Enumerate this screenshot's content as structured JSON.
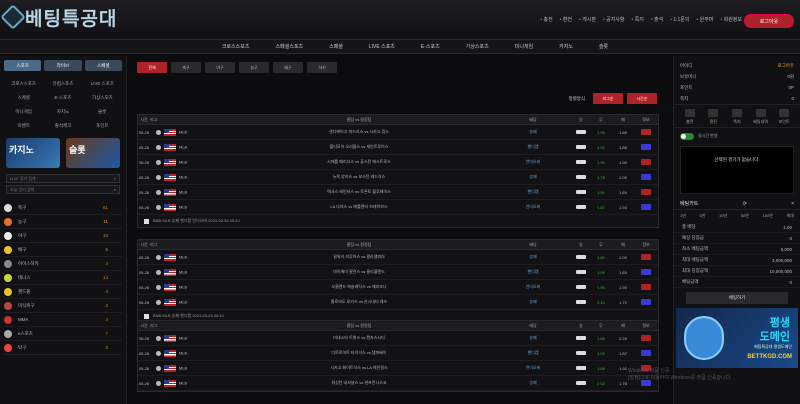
{
  "header": {
    "logo_text": "베팅특공대",
    "nav": [
      "충전",
      "환전",
      "게시판",
      "공지사항",
      "쪽지",
      "출석",
      "1:1문의",
      "원주머",
      "회원정보"
    ],
    "login_btn": "로그아웃"
  },
  "menu": [
    "크로스스포츠",
    "스페셜스포츠",
    "스페셜",
    "LIVE 스포츠",
    "E-스포츠",
    "가상스포츠",
    "미니게임",
    "카지노",
    "슬롯"
  ],
  "sidebar": {
    "btns": [
      "스포츠",
      "라이브",
      "스페셜"
    ],
    "grid": [
      "크로스스포츠",
      "유럽스포츠",
      "LIVE 스포츠",
      "스페셜",
      "E-스포츠",
      "가상스포츠",
      "미니게임",
      "카지노",
      "슬롯",
      "이벤트",
      "출석체크",
      "포인트"
    ],
    "banner_a": "카지노",
    "banner_b": "슬롯",
    "inputs": [
      "LIVE 경기 검색",
      "오늘 경기 검색"
    ],
    "sports": [
      {
        "name": "축구",
        "count": "61",
        "color": "#ddd"
      },
      {
        "name": "농구",
        "count": "11",
        "color": "#e8742a"
      },
      {
        "name": "야구",
        "count": "34",
        "color": "#eee"
      },
      {
        "name": "배구",
        "count": "5",
        "color": "#e8c42a"
      },
      {
        "name": "아이스하키",
        "count": "3",
        "color": "#888"
      },
      {
        "name": "테니스",
        "count": "14",
        "color": "#c8d83a"
      },
      {
        "name": "핸드볼",
        "count": "4",
        "color": "#e8c42a"
      },
      {
        "name": "미식축구",
        "count": "2",
        "color": "#b44"
      },
      {
        "name": "MMA",
        "count": "3",
        "color": "#c33"
      },
      {
        "name": "e스포츠",
        "count": "7",
        "color": "#aaa"
      },
      {
        "name": "탁구",
        "count": "2",
        "color": "#e44"
      }
    ]
  },
  "main": {
    "tabs": [
      "전체",
      "축구",
      "야구",
      "농구",
      "배구",
      "하키"
    ],
    "sort_label": "정렬방식",
    "sort_btns": [
      "리그순",
      "시간순"
    ],
    "tables": [
      {
        "head": [
          "시간",
          "리그",
          "홈팀 vs 원정팀",
          "배당",
          "승",
          "무",
          "패",
          "정보"
        ],
        "rows": [
          {
            "time": "05-26",
            "league": "MLB",
            "match": "샌디에이고 파드리스 vs 시카고 컵스",
            "market": "승패",
            "o1": "1.95",
            "o2": "",
            "o3": "1.85",
            "note": "정보"
          },
          {
            "time": "05-26",
            "league": "MLB",
            "match": "볼티모어 오리올스 vs 세인트루이스",
            "market": "핸디캡",
            "o1": "1.92",
            "o2": "",
            "o3": "1.88",
            "note": "정보"
          },
          {
            "time": "05-26",
            "league": "MLB",
            "match": "시애틀 매리너스 vs 휴스턴 애스트로스",
            "market": "언더오버",
            "o1": "1.90",
            "o2": "",
            "o3": "1.90",
            "note": "정보"
          },
          {
            "time": "05-26",
            "league": "MLB",
            "match": "뉴욕 양키스 vs 보스턴 레드삭스",
            "market": "승패",
            "o1": "1.75",
            "o2": "",
            "o3": "2.05",
            "note": "정보"
          },
          {
            "time": "05-26",
            "league": "MLB",
            "match": "텍사스 레인저스 vs 토론토 블루제이스",
            "market": "핸디캡",
            "o1": "1.91",
            "o2": "",
            "o3": "1.89",
            "note": "정보"
          },
          {
            "time": "05-26",
            "league": "MLB",
            "match": "LA 다저스 vs 애틀랜타 브레이브스",
            "market": "언더오버",
            "o1": "1.87",
            "o2": "",
            "o3": "1.93",
            "note": "정보"
          }
        ],
        "note": "BNB MLB 승패 핸디캡 언더오버 2023-05-26 05:40"
      },
      {
        "head": [
          "시간",
          "리그",
          "홈팀 vs 원정팀",
          "배당",
          "승",
          "무",
          "패",
          "정보"
        ],
        "rows": [
          {
            "time": "05-26",
            "league": "MLB",
            "match": "밀워키 브루어스 vs 필라델피아",
            "market": "승패",
            "o1": "1.80",
            "o2": "",
            "o3": "2.00",
            "note": "정보"
          },
          {
            "time": "05-26",
            "league": "MLB",
            "match": "마이애미 말린스 vs 클리블랜드",
            "market": "핸디캡",
            "o1": "1.95",
            "o2": "",
            "o3": "1.85",
            "note": "정보"
          },
          {
            "time": "05-26",
            "league": "MLB",
            "match": "오클랜드 애슬레틱스 vs 애리조나",
            "market": "언더오버",
            "o1": "1.90",
            "o2": "",
            "o3": "1.90",
            "note": "정보"
          },
          {
            "time": "05-26",
            "league": "MLB",
            "match": "콜로라도 로키스 vs 신시내티 레즈",
            "market": "승패",
            "o1": "2.10",
            "o2": "",
            "o3": "1.72",
            "note": "정보"
          }
        ],
        "note": "BNB MLB 승패 핸디캡 2023-05-26 06:10"
      },
      {
        "head": [
          "시간",
          "리그",
          "홈팀 vs 원정팀",
          "배당",
          "승",
          "무",
          "패",
          "정보"
        ],
        "rows": [
          {
            "time": "05-26",
            "league": "MLB",
            "match": "미네소타 트윈스 vs 캔자스시티",
            "market": "승패",
            "o1": "1.65",
            "o2": "",
            "o3": "2.25",
            "note": "정보"
          },
          {
            "time": "05-26",
            "league": "MLB",
            "match": "디트로이트 타이거스 vs 탬파베이",
            "market": "핸디캡",
            "o1": "1.93",
            "o2": "",
            "o3": "1.87",
            "note": "정보"
          },
          {
            "time": "05-26",
            "league": "MLB",
            "match": "시카고 화이트삭스 vs LA 에인절스",
            "market": "언더오버",
            "o1": "1.88",
            "o2": "",
            "o3": "1.92",
            "note": "정보"
          },
          {
            "time": "05-26",
            "league": "MLB",
            "match": "워싱턴 내셔널스 vs 샌프란시스코",
            "market": "승패",
            "o1": "2.02",
            "o2": "",
            "o3": "1.78",
            "note": "정보"
          }
        ]
      }
    ]
  },
  "right": {
    "info": [
      {
        "k": "아이디",
        "v": "로그아웃"
      },
      {
        "k": "보유머니",
        "v": "0원"
      },
      {
        "k": "포인트",
        "v": "0P"
      },
      {
        "k": "쪽지",
        "v": "0"
      }
    ],
    "icons": [
      "충전",
      "환전",
      "쪽지",
      "베팅내역",
      "포인트"
    ],
    "toggle": "실시간 반영",
    "slip_msg": "선택된 경기가 없습니다.",
    "slip_title": "베팅카트",
    "chips": [
      "1만",
      "5만",
      "10만",
      "50만",
      "100만",
      "최대"
    ],
    "lines": [
      {
        "k": "총 배당",
        "v": "1.00"
      },
      {
        "k": "예상 당첨금",
        "v": "0"
      },
      {
        "k": "최소 베팅금액",
        "v": "5,000"
      },
      {
        "k": "최대 베팅금액",
        "v": "3,000,000"
      },
      {
        "k": "최대 당첨금액",
        "v": "10,000,000"
      },
      {
        "k": "베팅금액",
        "v": "0"
      }
    ],
    "bet_btn": "베팅하기",
    "banner": {
      "t1": "평생",
      "t2": "도메인",
      "t3": "베팅특공대 평생도메인",
      "t4": "BETTKGD.COM"
    }
  },
  "watermark": {
    "l1": "Windows 정품 인증",
    "l2": "[설정]으로 이동하여 Windows를 정품 인증합니다."
  }
}
